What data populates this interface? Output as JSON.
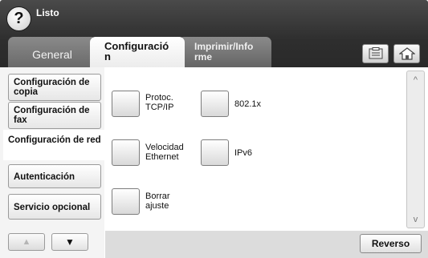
{
  "header": {
    "status": "Listo",
    "help_symbol": "?"
  },
  "tabs": [
    {
      "label": "General",
      "active": false
    },
    {
      "label": "Configuració\nn",
      "active": true
    },
    {
      "label": "Imprimir/Info\nrme",
      "active": false
    }
  ],
  "toolbar": {
    "copy_icon": "clipboard-icon",
    "home_icon": "home-icon"
  },
  "sidebar": {
    "items": [
      {
        "label": "Configuración de copia",
        "active": false
      },
      {
        "label": "Configuración de fax",
        "active": false
      },
      {
        "label": "Configuración de red",
        "active": true
      },
      {
        "label": "Autenticación",
        "active": false
      },
      {
        "label": "Servicio opcional",
        "active": false
      }
    ],
    "up_arrow": "▲",
    "down_arrow": "▼"
  },
  "options": [
    {
      "label": "Protoc.\nTCP/IP"
    },
    {
      "label": "802.1x"
    },
    {
      "label": "Velocidad\nEthernet"
    },
    {
      "label": "IPv6"
    },
    {
      "label": "Borrar\najuste"
    }
  ],
  "scroll": {
    "up_symbol": "^",
    "down_symbol": "v"
  },
  "footer": {
    "back_label": "Reverso"
  },
  "colors": {
    "frame": "#2e2e2e",
    "inactive_tab": "#7a7a7a",
    "panel": "#dcdcdc"
  }
}
